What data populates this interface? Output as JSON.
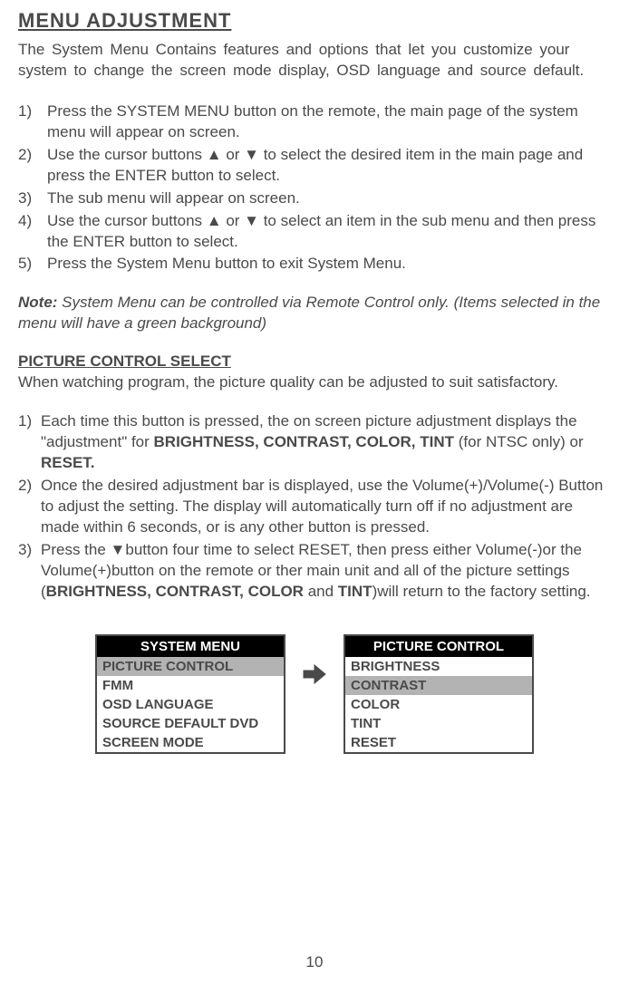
{
  "title": "MENU ADJUSTMENT",
  "intro": "The System Menu Contains features and options that let you customize your system to change the screen mode display, OSD language and source default.",
  "steps1": {
    "s1_num": "1)",
    "s1": "Press the SYSTEM MENU button on the remote, the main page of the system menu will appear on screen.",
    "s2_num": "2)",
    "s2a": "Use the cursor buttons ",
    "s2b": " or ",
    "s2c": " to select the desired item in the main page and press the ENTER button to select.",
    "s3_num": "3)",
    "s3": "The sub menu will appear on screen.",
    "s4_num": "4)",
    "s4a": "Use the cursor buttons ",
    "s4b": " or ",
    "s4c": " to select an item in the sub menu and then press the ENTER button to select.",
    "s5_num": "5)",
    "s5": "Press the System Menu button to exit System Menu."
  },
  "note_label": "Note:",
  "note_text": " System Menu can be controlled via Remote Control only. (Items selected in the menu will have a green background)",
  "subheading": "PICTURE CONTROL SELECT",
  "sub_intro": "When watching program, the picture quality can be adjusted to suit satisfactory.",
  "steps2": {
    "s1_num": "1)",
    "s1a": "Each time this button is pressed, the on screen picture adjustment displays the \"adjustment\" for ",
    "s1b": "BRIGHTNESS, CONTRAST, COLOR, TINT",
    "s1c": " (for NTSC only) or ",
    "s1d": "RESET.",
    "s2_num": "2)",
    "s2": "Once the desired adjustment bar is displayed, use the Volume(+)/Volume(-) Button to adjust the setting. The display will automatically turn off if no adjustment are made within 6 seconds, or is any other button is pressed.",
    "s3_num": "3)",
    "s3a": "Press the ",
    "s3b": "button four time to select RESET, then press either Volume(-)or the Volume(+)button on the remote or ther main unit and all of the picture settings (",
    "s3c": "BRIGHTNESS, CONTRAST, COLOR",
    "s3d": " and ",
    "s3e": "TINT",
    "s3f": ")will return to the factory setting."
  },
  "menu1": {
    "header": "SYSTEM MENU",
    "i1": "PICTURE CONTROL",
    "i2": "FMM",
    "i3": "OSD LANGUAGE",
    "i4": "SOURCE DEFAULT DVD",
    "i5": "SCREEN MODE"
  },
  "menu2": {
    "header": "PICTURE CONTROL",
    "i1": "BRIGHTNESS",
    "i2": "CONTRAST",
    "i3": "COLOR",
    "i4": "TINT",
    "i5": "RESET"
  },
  "icons": {
    "up": "▲",
    "down": "▼"
  },
  "page_number": "10"
}
